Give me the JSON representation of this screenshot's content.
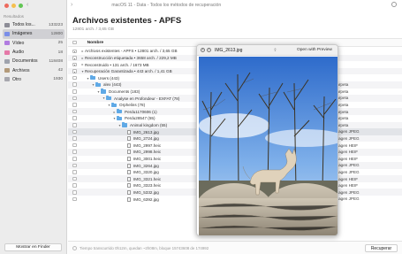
{
  "window": {
    "title": "macOS 11 - Data - Todos los métodos de recuperación"
  },
  "sidebar": {
    "section": "Resultados",
    "items": [
      {
        "label": "Todos los...",
        "count": "133223",
        "color": "#8c8c96",
        "active": false
      },
      {
        "label": "Imágenes",
        "count": "12800",
        "color": "#7a8ee8",
        "active": true
      },
      {
        "label": "Vídeo",
        "count": "25",
        "color": "#b07ce0",
        "active": false
      },
      {
        "label": "Audio",
        "count": "18",
        "color": "#e579a8",
        "active": false
      },
      {
        "label": "Documentos",
        "count": "118408",
        "color": "#9fa3ad",
        "active": false
      },
      {
        "label": "Archivos",
        "count": "42",
        "color": "#b39a7a",
        "active": false
      },
      {
        "label": "Otro",
        "count": "1930",
        "color": "#a7a7ae",
        "active": false
      }
    ],
    "finder_button": "Mostrar en Finder"
  },
  "main": {
    "title": "Archivos existentes - APFS",
    "subtitle": "12801 arch. / 3,65 GB",
    "column_name": "Nombre",
    "rows": [
      {
        "indent": 0,
        "chev": ">",
        "icon": "none",
        "label": "Archivos existentes - APFS • 12801 arch. / 3,65 GB",
        "type": ""
      },
      {
        "indent": 0,
        "chev": ">",
        "icon": "none",
        "label": "Reconstrucción etiquetada • 3658 arch. / 229,2 MB",
        "type": ""
      },
      {
        "indent": 0,
        "chev": ">",
        "icon": "none",
        "label": "Reconstruido • 131 arch. / 1673 MB",
        "type": ""
      },
      {
        "indent": 0,
        "chev": "v",
        "icon": "none",
        "label": "Recuperación Garantizada • 443 arch. / 1,41 GB",
        "type": ""
      },
      {
        "indent": 1,
        "chev": "v",
        "icon": "folder",
        "label": "Users (443)",
        "type": ""
      },
      {
        "indent": 2,
        "chev": "v",
        "icon": "folder",
        "label": "alex (443)",
        "type": "Carpeta"
      },
      {
        "indent": 3,
        "chev": "v",
        "icon": "folder",
        "label": "Documents (183)",
        "type": "Carpeta"
      },
      {
        "indent": 4,
        "chev": "v",
        "icon": "folder",
        "label": "Analyse en Profondeur - EXFAT (78)",
        "type": "Carpeta"
      },
      {
        "indent": 5,
        "chev": "v",
        "icon": "folder",
        "label": "Orphelins (78)",
        "type": "Carpeta"
      },
      {
        "indent": 6,
        "chev": ">",
        "icon": "folder",
        "label": "Perdu1170606 (1)",
        "type": "Carpeta"
      },
      {
        "indent": 6,
        "chev": "v",
        "icon": "folder",
        "label": "Perdu28547 (55)",
        "type": "Carpeta"
      },
      {
        "indent": 7,
        "chev": "v",
        "icon": "folder",
        "label": "Animal kingdom (55)",
        "type": "Carpeta"
      },
      {
        "indent": 8,
        "chev": "",
        "icon": "file",
        "label": "IMG_2613.jpg",
        "type": "Imagen JPEG"
      },
      {
        "indent": 8,
        "chev": "",
        "icon": "file",
        "label": "IMG_2724.jpg",
        "type": "Imagen JPEG"
      },
      {
        "indent": 8,
        "chev": "",
        "icon": "file",
        "label": "IMG_2997.heic",
        "type": "Imagen HEIF"
      },
      {
        "indent": 8,
        "chev": "",
        "icon": "file",
        "label": "IMG_2998.heic",
        "type": "Imagen HEIF"
      },
      {
        "indent": 8,
        "chev": "",
        "icon": "file",
        "label": "IMG_3001.heic",
        "type": "Imagen HEIF"
      },
      {
        "indent": 8,
        "chev": "",
        "icon": "file",
        "label": "IMG_3264.jpg",
        "type": "Imagen JPEG"
      },
      {
        "indent": 8,
        "chev": "",
        "icon": "file",
        "label": "IMG_3320.jpg",
        "type": "Imagen JPEG"
      },
      {
        "indent": 8,
        "chev": "",
        "icon": "file",
        "label": "IMG_3321.heic",
        "type": "Imagen HEIF"
      },
      {
        "indent": 8,
        "chev": "",
        "icon": "file",
        "label": "IMG_3323.heic",
        "type": "Imagen HEIF"
      },
      {
        "indent": 8,
        "chev": "",
        "icon": "file",
        "label": "IMG_5332.jpg",
        "type": "Imagen JPEG"
      },
      {
        "indent": 8,
        "chev": "",
        "icon": "file",
        "label": "IMG_6392.jpg",
        "type": "Imagen JPEG"
      }
    ]
  },
  "status": {
    "text": "Tiempo transcurrido 0h12m, quedan ~2h08m, bloque 15743608 de 174992"
  },
  "recover_button": "Recuperar",
  "preview": {
    "filename": "IMG_2613.jpg",
    "open_label": "Open with Preview"
  }
}
